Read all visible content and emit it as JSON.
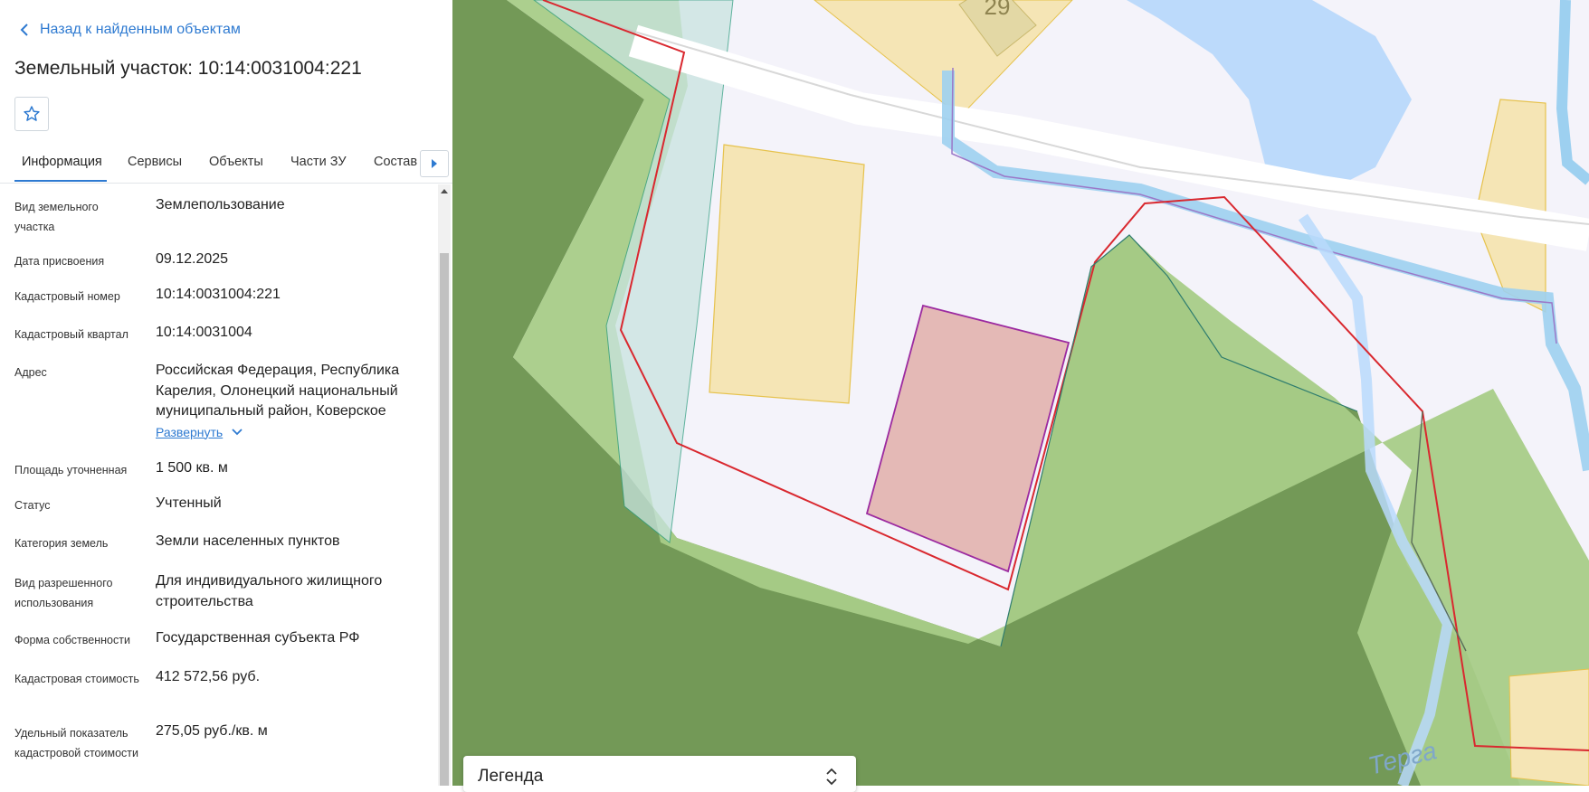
{
  "nav": {
    "back_label": "Назад к найденным объектам"
  },
  "header": {
    "title": "Земельный участок: 10:14:0031004:221"
  },
  "tabs": [
    {
      "label": "Информация"
    },
    {
      "label": "Сервисы"
    },
    {
      "label": "Объекты"
    },
    {
      "label": "Части ЗУ"
    },
    {
      "label": "Состав"
    }
  ],
  "info": {
    "vid_uchastka": {
      "label": "Вид земельного участка",
      "value": "Землепользование"
    },
    "data": {
      "label": "Дата присвоения",
      "value": "09.12.2025"
    },
    "kad_nomer": {
      "label": "Кадастровый номер",
      "value": "10:14:0031004:221"
    },
    "kvartal": {
      "label": "Кадастровый квартал",
      "value": "10:14:0031004"
    },
    "adres": {
      "label": "Адрес",
      "value": "Российская Федерация, Республика Карелия, Олонецкий национальный муниципальный район, Коверское",
      "expand_label": "Развернуть"
    },
    "ploshchad": {
      "label": "Площадь уточненная",
      "value": "1 500 кв. м"
    },
    "status": {
      "label": "Статус",
      "value": "Учтенный"
    },
    "kategoriya": {
      "label": "Категория земель",
      "value": "Земли населенных пунктов"
    },
    "vid_ispolz": {
      "label": "Вид разрешенного использования",
      "value": "Для индивидуального жилищного строительства"
    },
    "forma": {
      "label": "Форма собственности",
      "value": "Государственная субъекта РФ"
    },
    "stoimost": {
      "label": "Кадастровая стоимость",
      "value": "412 572,56 руб."
    },
    "udelny": {
      "label": "Удельный показатель кадастровой стоимости",
      "value": "275,05 руб./кв. м"
    }
  },
  "map": {
    "building_number": "29",
    "river_label": "Терга"
  },
  "legend": {
    "title": "Легенда"
  },
  "colors": {
    "accent": "#2e7ad1",
    "forest_dark": "#739957",
    "forest_light": "#a8cc88",
    "water": "#b9d9fb",
    "parcel_border": "#d9282f"
  }
}
